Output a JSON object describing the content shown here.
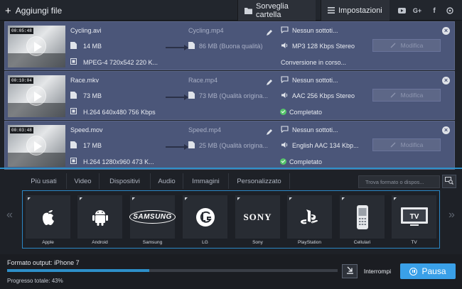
{
  "toolbar": {
    "add_files_label": "Aggiungi file",
    "watch_folder_label": "Sorveglia cartella",
    "settings_label": "Impostazioni",
    "social_icons": [
      "youtube-icon",
      "google-plus-icon",
      "facebook-icon",
      "vk-icon"
    ]
  },
  "files": [
    {
      "thumb_time": "00:05:48",
      "name": "Cycling.avi",
      "size": "14 MB",
      "video_info": "MPEG-4 720x542 220 K...",
      "output_name": "Cycling.mp4",
      "output_size": "86 MB (Buona qualità)",
      "subtitles": "Nessun sottoti...",
      "audio": "MP3 128 Kbps Stereo",
      "status": "Conversione in corso...",
      "completed": false,
      "modify_label": "Modifica"
    },
    {
      "thumb_time": "00:10:04",
      "name": "Race.mkv",
      "size": "73 MB",
      "video_info": "H.264 640x480 756 Kbps",
      "output_name": "Race.mp4",
      "output_size": "73 MB (Qualità origina...",
      "subtitles": "Nessun sottoti...",
      "audio": "AAC 256 Kbps Stereo",
      "status": "Completato",
      "completed": true,
      "modify_label": "Modifica"
    },
    {
      "thumb_time": "00:03:48",
      "name": "Speed.mov",
      "size": "17 MB",
      "video_info": "H.264 1280x960 473 K...",
      "output_name": "Speed.mp4",
      "output_size": "25 MB (Qualità origina...",
      "subtitles": "Nessun sottoti...",
      "audio": "English AAC 134 Kbp...",
      "status": "Completato",
      "completed": true,
      "modify_label": "Modifica"
    }
  ],
  "format_tabs": [
    "Più usati",
    "Video",
    "Dispositivi",
    "Audio",
    "Immagini",
    "Personalizzato"
  ],
  "search": {
    "placeholder": "Trova formato o dispos..."
  },
  "devices": [
    {
      "label": "Apple",
      "icon": "apple-icon"
    },
    {
      "label": "Android",
      "icon": "android-icon"
    },
    {
      "label": "Samsung",
      "icon": "samsung-icon",
      "logo_text": "SAMSUNG"
    },
    {
      "label": "LG",
      "icon": "lg-icon",
      "logo_text": "LG"
    },
    {
      "label": "Sony",
      "icon": "sony-icon",
      "logo_text": "SONY"
    },
    {
      "label": "PlayStation",
      "icon": "playstation-icon"
    },
    {
      "label": "Cellulari",
      "icon": "mobile-phone-icon"
    },
    {
      "label": "TV",
      "icon": "tv-icon",
      "logo_text": "TV"
    }
  ],
  "bottom": {
    "output_format_label": "Formato output:",
    "output_format_value": "iPhone 7",
    "progress_label": "Progresso totale:",
    "progress_value": "43%",
    "progress_fraction": 0.43,
    "stop_label": "Interrompi",
    "pause_label": "Pausa"
  },
  "colors": {
    "accent": "#3aa0e8",
    "row_bg": "#4b5679",
    "done": "#55c46a"
  }
}
